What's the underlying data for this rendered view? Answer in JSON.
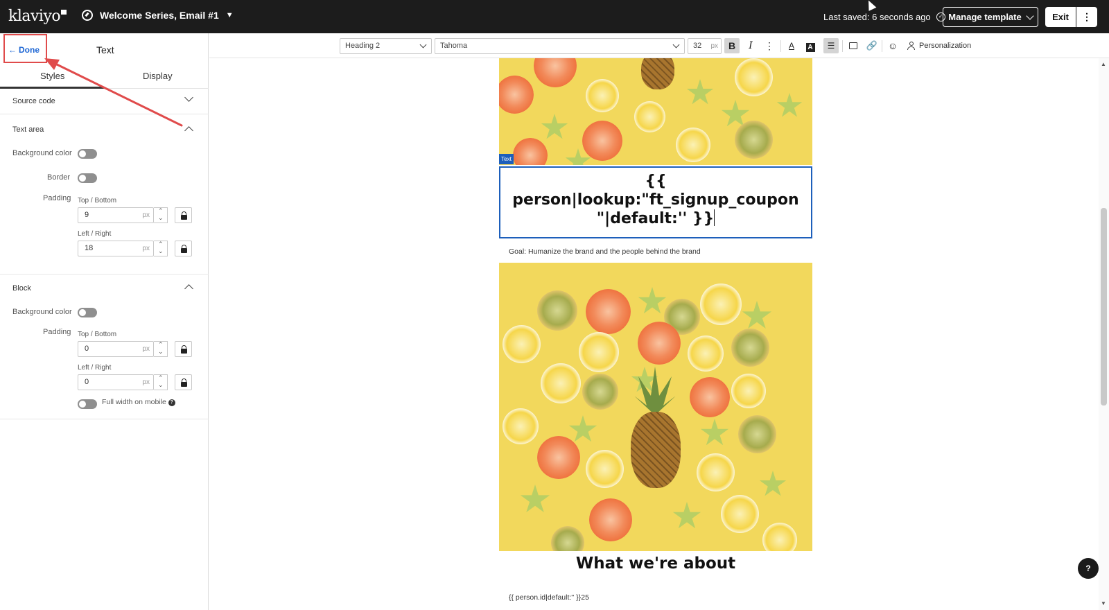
{
  "app": {
    "logo": "klaviyo",
    "campaign_title": "Welcome Series, Email #1",
    "last_saved": "Last saved: 6 seconds ago",
    "manage_template_label": "Manage template",
    "exit_label": "Exit"
  },
  "panel": {
    "done_label": "Done",
    "title": "Text",
    "tabs": [
      {
        "label": "Styles",
        "active": true
      },
      {
        "label": "Display",
        "active": false
      }
    ],
    "source_code_label": "Source code",
    "text_area": {
      "label": "Text area",
      "background_color_label": "Background color",
      "background_color_on": false,
      "border_label": "Border",
      "border_on": false,
      "padding_label": "Padding",
      "top_bottom_label": "Top / Bottom",
      "top_bottom_value": "9",
      "left_right_label": "Left / Right",
      "left_right_value": "18",
      "unit": "px"
    },
    "block": {
      "label": "Block",
      "background_color_label": "Background color",
      "background_color_on": false,
      "padding_label": "Padding",
      "top_bottom_label": "Top / Bottom",
      "top_bottom_value": "0",
      "left_right_label": "Left / Right",
      "left_right_value": "0",
      "unit": "px",
      "full_width_label": "Full width on mobile",
      "full_width_on": false
    },
    "annotation_color": "#e04b4b"
  },
  "toolbar": {
    "style_select": "Heading 2",
    "font_select": "Tahoma",
    "font_size": "32",
    "font_size_unit": "px",
    "bold_icon": "bold-icon",
    "italic_icon": "italic-icon",
    "personalization_label": "Personalization"
  },
  "canvas": {
    "text_tag": "Text",
    "heading_line1": "{{",
    "heading_line2": "person|lookup:\"ft_signup_coupon",
    "heading_line3": "\"|default:'' }}",
    "goal_text": "Goal: Humanize the brand and the people behind the brand",
    "about_heading": "What we're about",
    "footer_code": "{{ person.id|default:'' }}25",
    "help_label": "?"
  },
  "colors": {
    "topbar": "#1c1c1c",
    "accent_blue": "#1d5fbb",
    "fruit_bg": "#f2d85c"
  }
}
